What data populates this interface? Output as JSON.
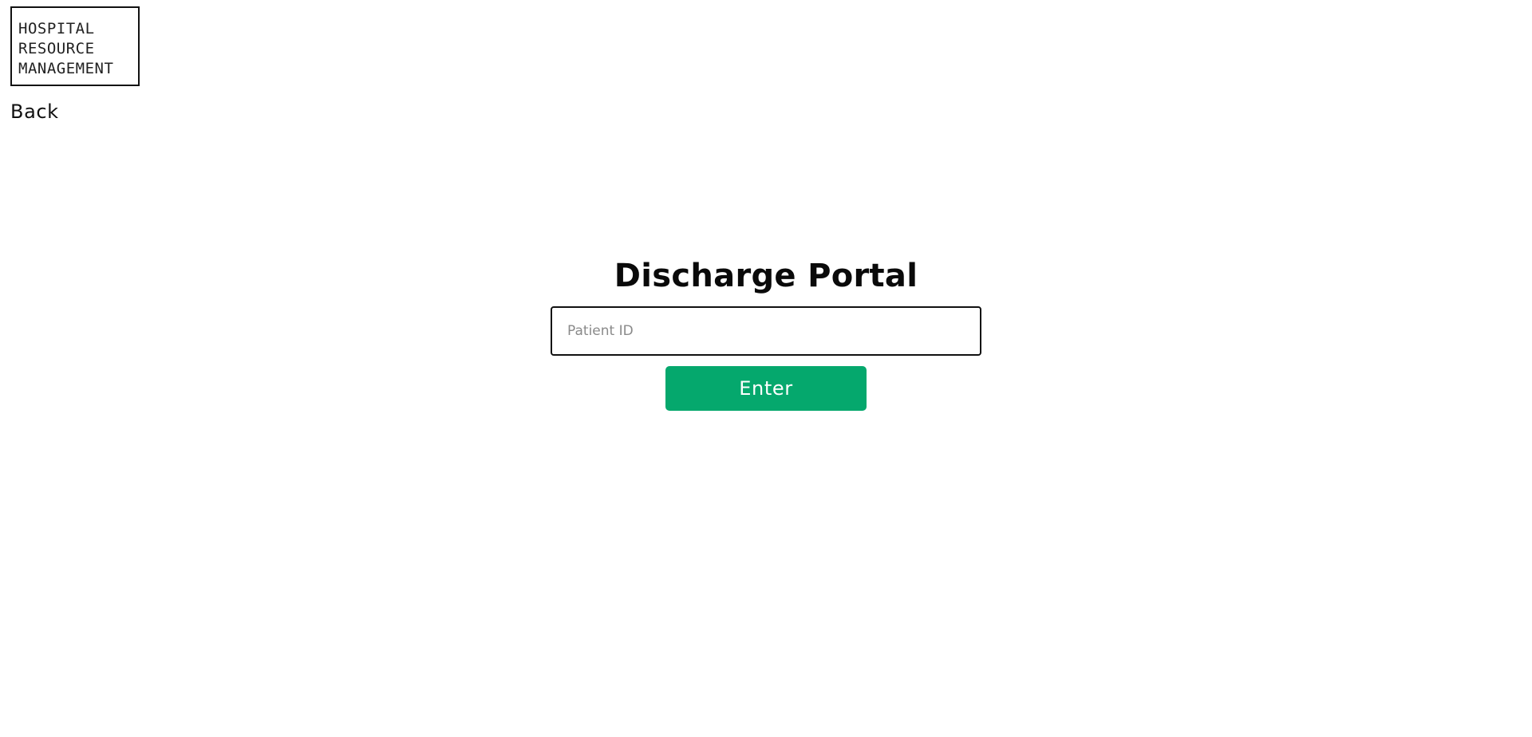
{
  "logo": {
    "lines": [
      "HOSPITAL",
      "RESOURCE",
      "MANAGEMENT"
    ]
  },
  "nav": {
    "back_label": "Back"
  },
  "portal": {
    "title": "Discharge Portal",
    "patient_id": {
      "placeholder": "Patient ID",
      "value": ""
    },
    "enter_label": "Enter"
  },
  "colors": {
    "accent": "#05a86d",
    "text": "#111111",
    "background": "#ffffff"
  }
}
